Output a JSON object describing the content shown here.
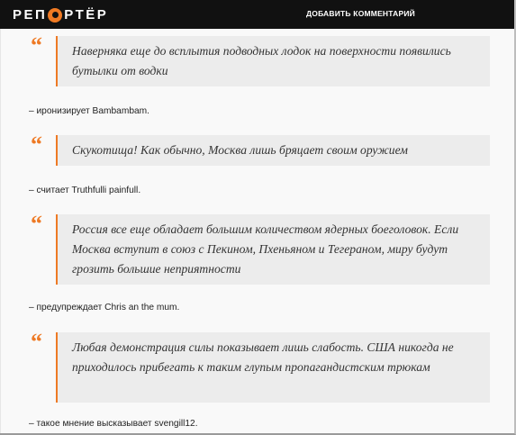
{
  "header": {
    "logo_text_left": "РЕП",
    "logo_text_right": "РТЁР",
    "add_comment_label": "ДОБАВИТЬ КОММЕНТАРИЙ"
  },
  "quotes": [
    {
      "mark": "“",
      "text": "Наверняка еще до всплытия подводных лодок на поверхности появились бутылки от водки",
      "attribution": "– иронизирует Bambambam."
    },
    {
      "mark": "“",
      "text": "Скукотища! Как обычно, Москва лишь бряцает своим оружием",
      "attribution": "– считает Truthfulli painfull."
    },
    {
      "mark": "“",
      "text": "Россия все еще обладает большим количеством ядерных боеголовок. Если Москва вступит в союз с Пекином, Пхеньяном и Тегераном, миру будут грозить большие неприятности",
      "attribution": "– предупреждает Chris an the mum."
    },
    {
      "mark": "“",
      "text": "Любая демонстрация силы показывает лишь слабость. США никогда не приходилось прибегать к таким глупым пропагандистским трюкам",
      "attribution": "– такое мнение высказывает svengill12."
    }
  ],
  "colors": {
    "accent": "#ee7a25",
    "header_bg": "#111111",
    "quote_bg": "#ececec"
  }
}
